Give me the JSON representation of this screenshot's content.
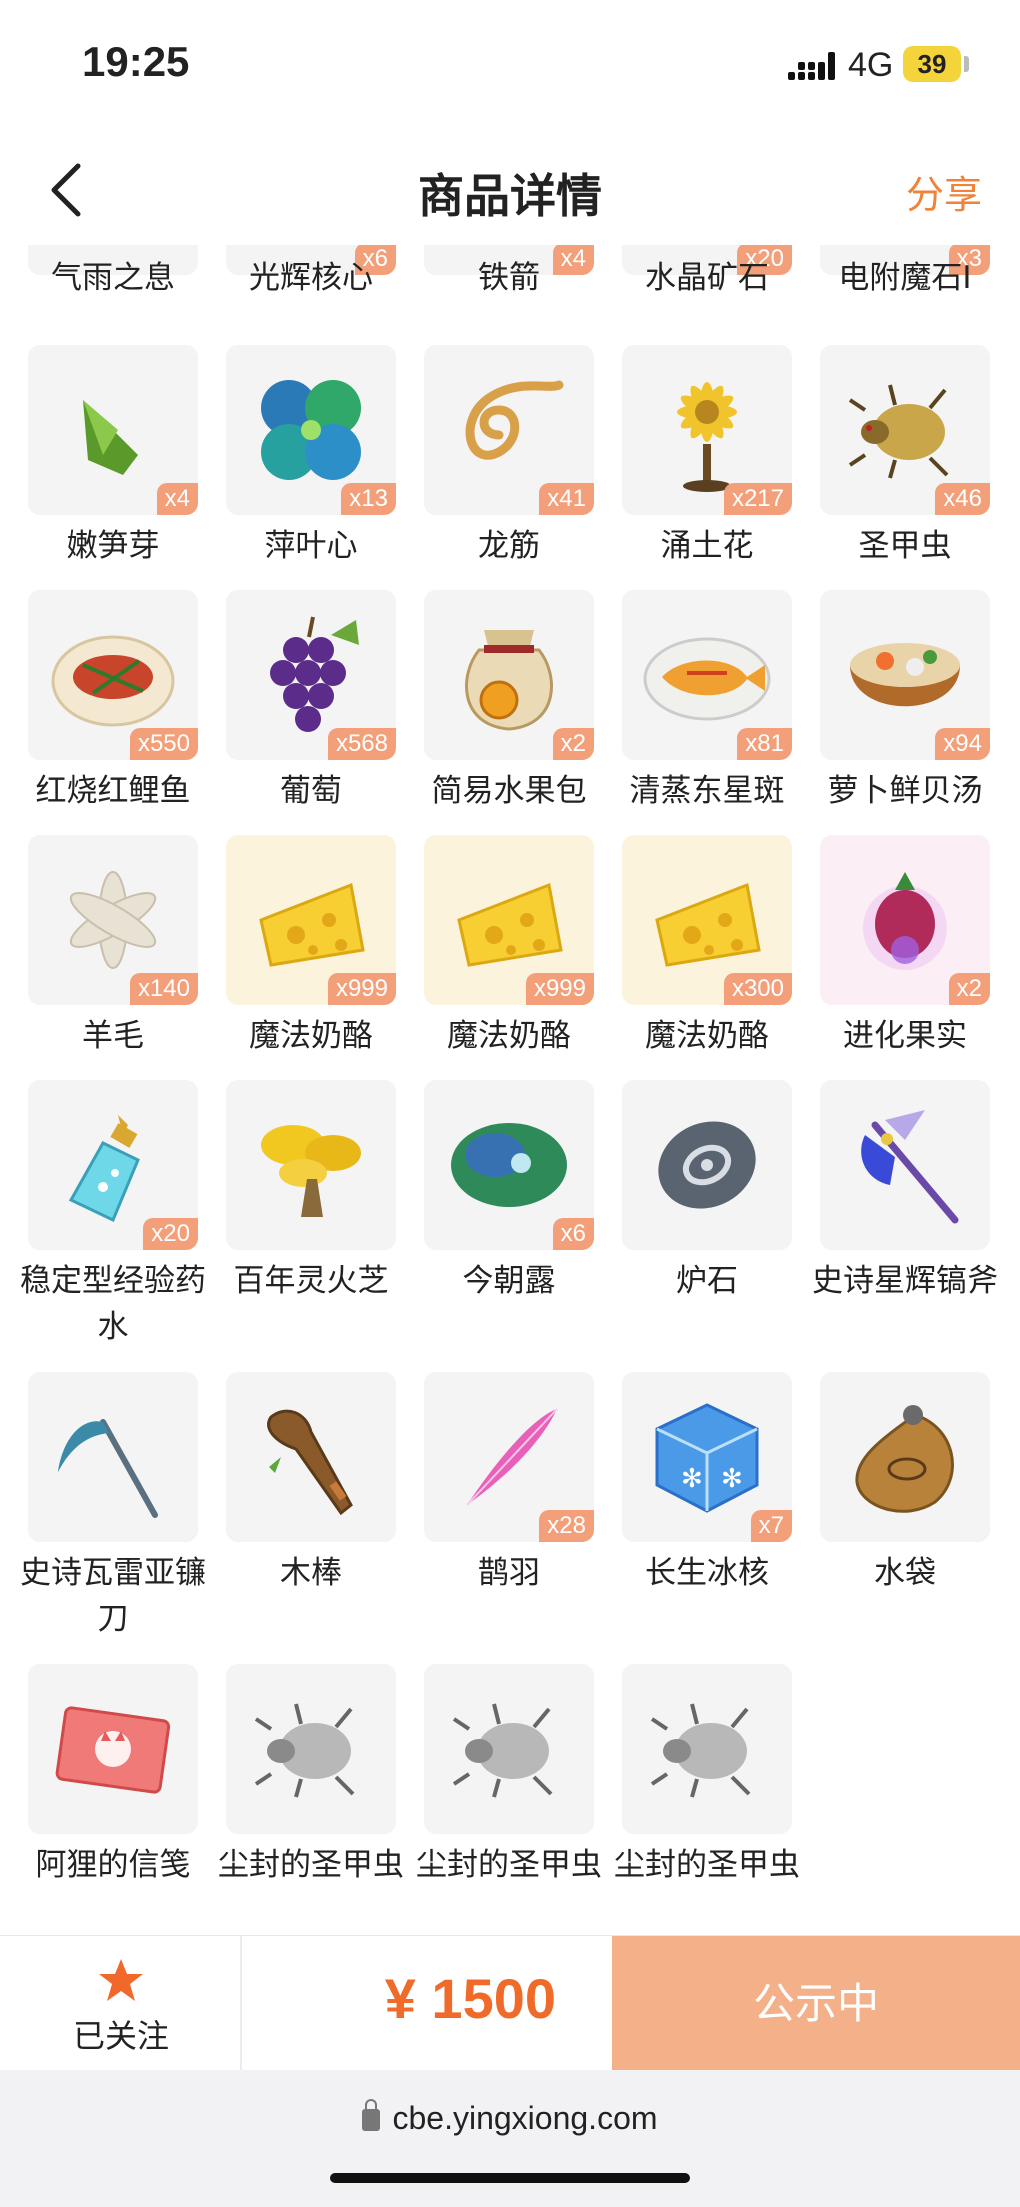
{
  "status_bar": {
    "time": "19:25",
    "network": "4G",
    "battery": "39"
  },
  "header": {
    "title": "商品详情",
    "share_label": "分享"
  },
  "items": [
    {
      "name": "气雨之息",
      "count": "",
      "icon": "partial-item-icon"
    },
    {
      "name": "光辉核心",
      "count": "x6",
      "icon": "partial-item-icon"
    },
    {
      "name": "铁箭",
      "count": "x4",
      "icon": "partial-item-icon"
    },
    {
      "name": "水晶矿石",
      "count": "x20",
      "icon": "partial-item-icon"
    },
    {
      "name": "电附魔石I",
      "count": "x3",
      "icon": "partial-item-icon"
    },
    {
      "name": "嫩笋芽",
      "count": "x4",
      "icon": "bamboo-shoot-icon"
    },
    {
      "name": "萍叶心",
      "count": "x13",
      "icon": "clover-leaf-icon"
    },
    {
      "name": "龙筋",
      "count": "x41",
      "icon": "dragon-tendon-icon"
    },
    {
      "name": "涌土花",
      "count": "x217",
      "icon": "sunflower-icon"
    },
    {
      "name": "圣甲虫",
      "count": "x46",
      "icon": "scarab-beetle-icon"
    },
    {
      "name": "红烧红鲤鱼",
      "count": "x550",
      "icon": "braised-fish-dish-icon"
    },
    {
      "name": "葡萄",
      "count": "x568",
      "icon": "grapes-icon"
    },
    {
      "name": "简易水果包",
      "count": "x2",
      "icon": "fruit-bag-icon"
    },
    {
      "name": "清蒸东星斑",
      "count": "x81",
      "icon": "steamed-fish-dish-icon"
    },
    {
      "name": "萝卜鲜贝汤",
      "count": "x94",
      "icon": "soup-bowl-icon"
    },
    {
      "name": "羊毛",
      "count": "x140",
      "icon": "wool-icon"
    },
    {
      "name": "魔法奶酪",
      "count": "x999",
      "icon": "cheese-icon"
    },
    {
      "name": "魔法奶酪",
      "count": "x999",
      "icon": "cheese-icon"
    },
    {
      "name": "魔法奶酪",
      "count": "x300",
      "icon": "cheese-icon"
    },
    {
      "name": "进化果实",
      "count": "x2",
      "icon": "evolution-fruit-icon"
    },
    {
      "name": "稳定型经验药水",
      "count": "x20",
      "icon": "potion-bottle-icon"
    },
    {
      "name": "百年灵火芝",
      "count": "",
      "icon": "lingzhi-mushroom-icon"
    },
    {
      "name": "今朝露",
      "count": "x6",
      "icon": "dew-leaf-icon"
    },
    {
      "name": "炉石",
      "count": "",
      "icon": "hearthstone-icon"
    },
    {
      "name": "史诗星辉镐斧",
      "count": "",
      "icon": "pickaxe-icon"
    },
    {
      "name": "史诗瓦雷亚镰刀",
      "count": "",
      "icon": "scythe-icon"
    },
    {
      "name": "木棒",
      "count": "",
      "icon": "wooden-club-icon"
    },
    {
      "name": "鹊羽",
      "count": "x28",
      "icon": "feather-icon"
    },
    {
      "name": "长生冰核",
      "count": "x7",
      "icon": "ice-cube-icon"
    },
    {
      "name": "水袋",
      "count": "",
      "icon": "water-pouch-icon"
    },
    {
      "name": "阿狸的信笺",
      "count": "",
      "icon": "letter-envelope-icon"
    },
    {
      "name": "尘封的圣甲虫",
      "count": "",
      "icon": "dusty-beetle-icon"
    },
    {
      "name": "尘封的圣甲虫",
      "count": "",
      "icon": "dusty-beetle-icon"
    },
    {
      "name": "尘封的圣甲虫",
      "count": "",
      "icon": "dusty-beetle-icon"
    }
  ],
  "bottom_bar": {
    "follow_label": "已关注",
    "price": "¥ 1500",
    "status_label": "公示中"
  },
  "url_bar": {
    "url": "cbe.yingxiong.com"
  },
  "colors": {
    "accent": "#f0833a",
    "badge": "#f3a07a",
    "button": "#f3b089",
    "price": "#f06a2a"
  }
}
